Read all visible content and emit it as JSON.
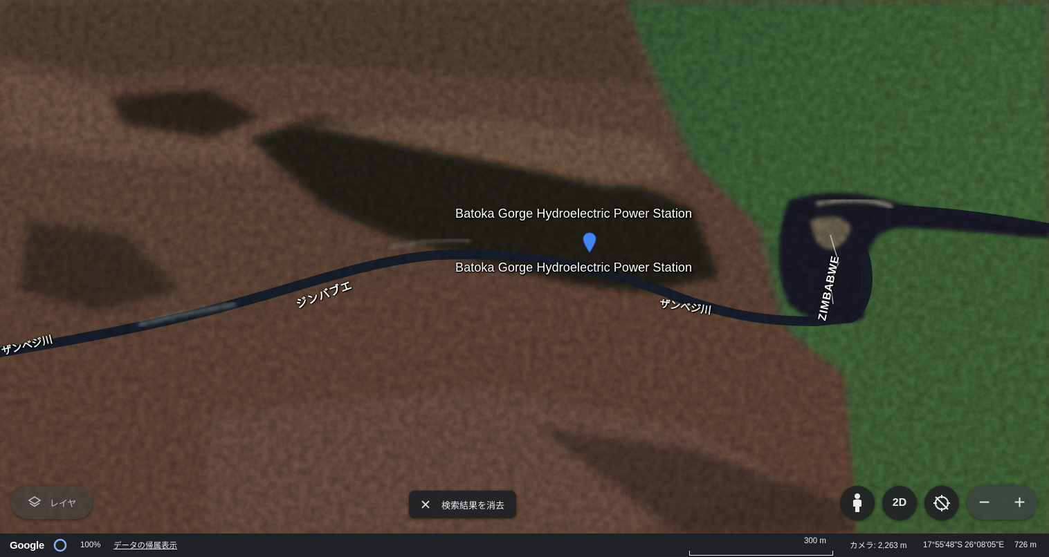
{
  "map": {
    "place_title_top": "Batoka Gorge Hydroelectric Power Station",
    "place_title_bottom": "Batoka Gorge Hydroelectric Power Station",
    "river_label_left": "ザンベジ川",
    "river_label_right": "ザンベジ川",
    "country_label_jp": "ジンバブエ",
    "country_label_en": "ZIMBABWE",
    "pin_color": "#4285f4"
  },
  "controls": {
    "layers_label": "レイヤ",
    "clear_search_label": "検索結果を消去",
    "view_mode_label": "2D"
  },
  "status_bar": {
    "logo": "Google",
    "progress": "100%",
    "attribution": "データの帰属表示",
    "scale_label": "300 m",
    "camera": "カメラ: 2,263 m",
    "coordinates": "17°55'48\"S 26°08'05\"E",
    "elevation": "726 m"
  }
}
